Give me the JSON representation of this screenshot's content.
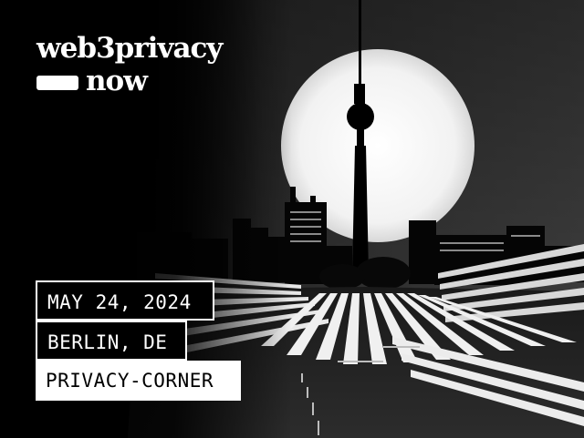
{
  "brand": {
    "name": "web3privacy",
    "suffix": "now"
  },
  "event": {
    "date": "MAY 24, 2024",
    "location": "BERLIN, DE",
    "venue": "PRIVACY-CORNER"
  },
  "colors": {
    "background": "#000000",
    "foreground": "#ffffff"
  },
  "artwork": {
    "subject": "berlin-tv-tower-with-moon",
    "style": "black-and-white"
  }
}
